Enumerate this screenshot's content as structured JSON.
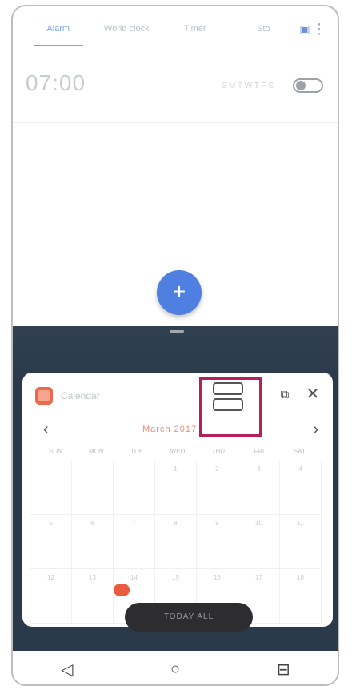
{
  "top_app": {
    "tabs": [
      {
        "label": "Alarm",
        "active": true
      },
      {
        "label": "World clock",
        "active": false
      },
      {
        "label": "Timer",
        "active": false
      },
      {
        "label": "Sto",
        "active": false
      }
    ],
    "alarm": {
      "time": "07:00",
      "days": "S M T W T F S"
    }
  },
  "calendar": {
    "app_name": "Calendar",
    "month": "March 2017",
    "weekdays": [
      "SUN",
      "MON",
      "TUE",
      "WED",
      "THU",
      "FRI",
      "SAT"
    ],
    "dates_row1": [
      "",
      "",
      "",
      "1",
      "2",
      "3",
      "4"
    ],
    "dates_row2": [
      "5",
      "6",
      "7",
      "8",
      "9",
      "10",
      "11"
    ],
    "dates_row3": [
      "12",
      "13",
      "14",
      "15",
      "16",
      "17",
      "18"
    ],
    "pill_label": "TODAY ALL"
  },
  "icons": {
    "prev": "‹",
    "next": "›",
    "close": "✕",
    "popout": "⧉",
    "fab": "+",
    "back": "◁",
    "home": "○",
    "recents": "⊟"
  },
  "colors": {
    "accent": "#4f7fe0",
    "highlight": "#b3205b",
    "calendar_red": "#e95a3e"
  }
}
